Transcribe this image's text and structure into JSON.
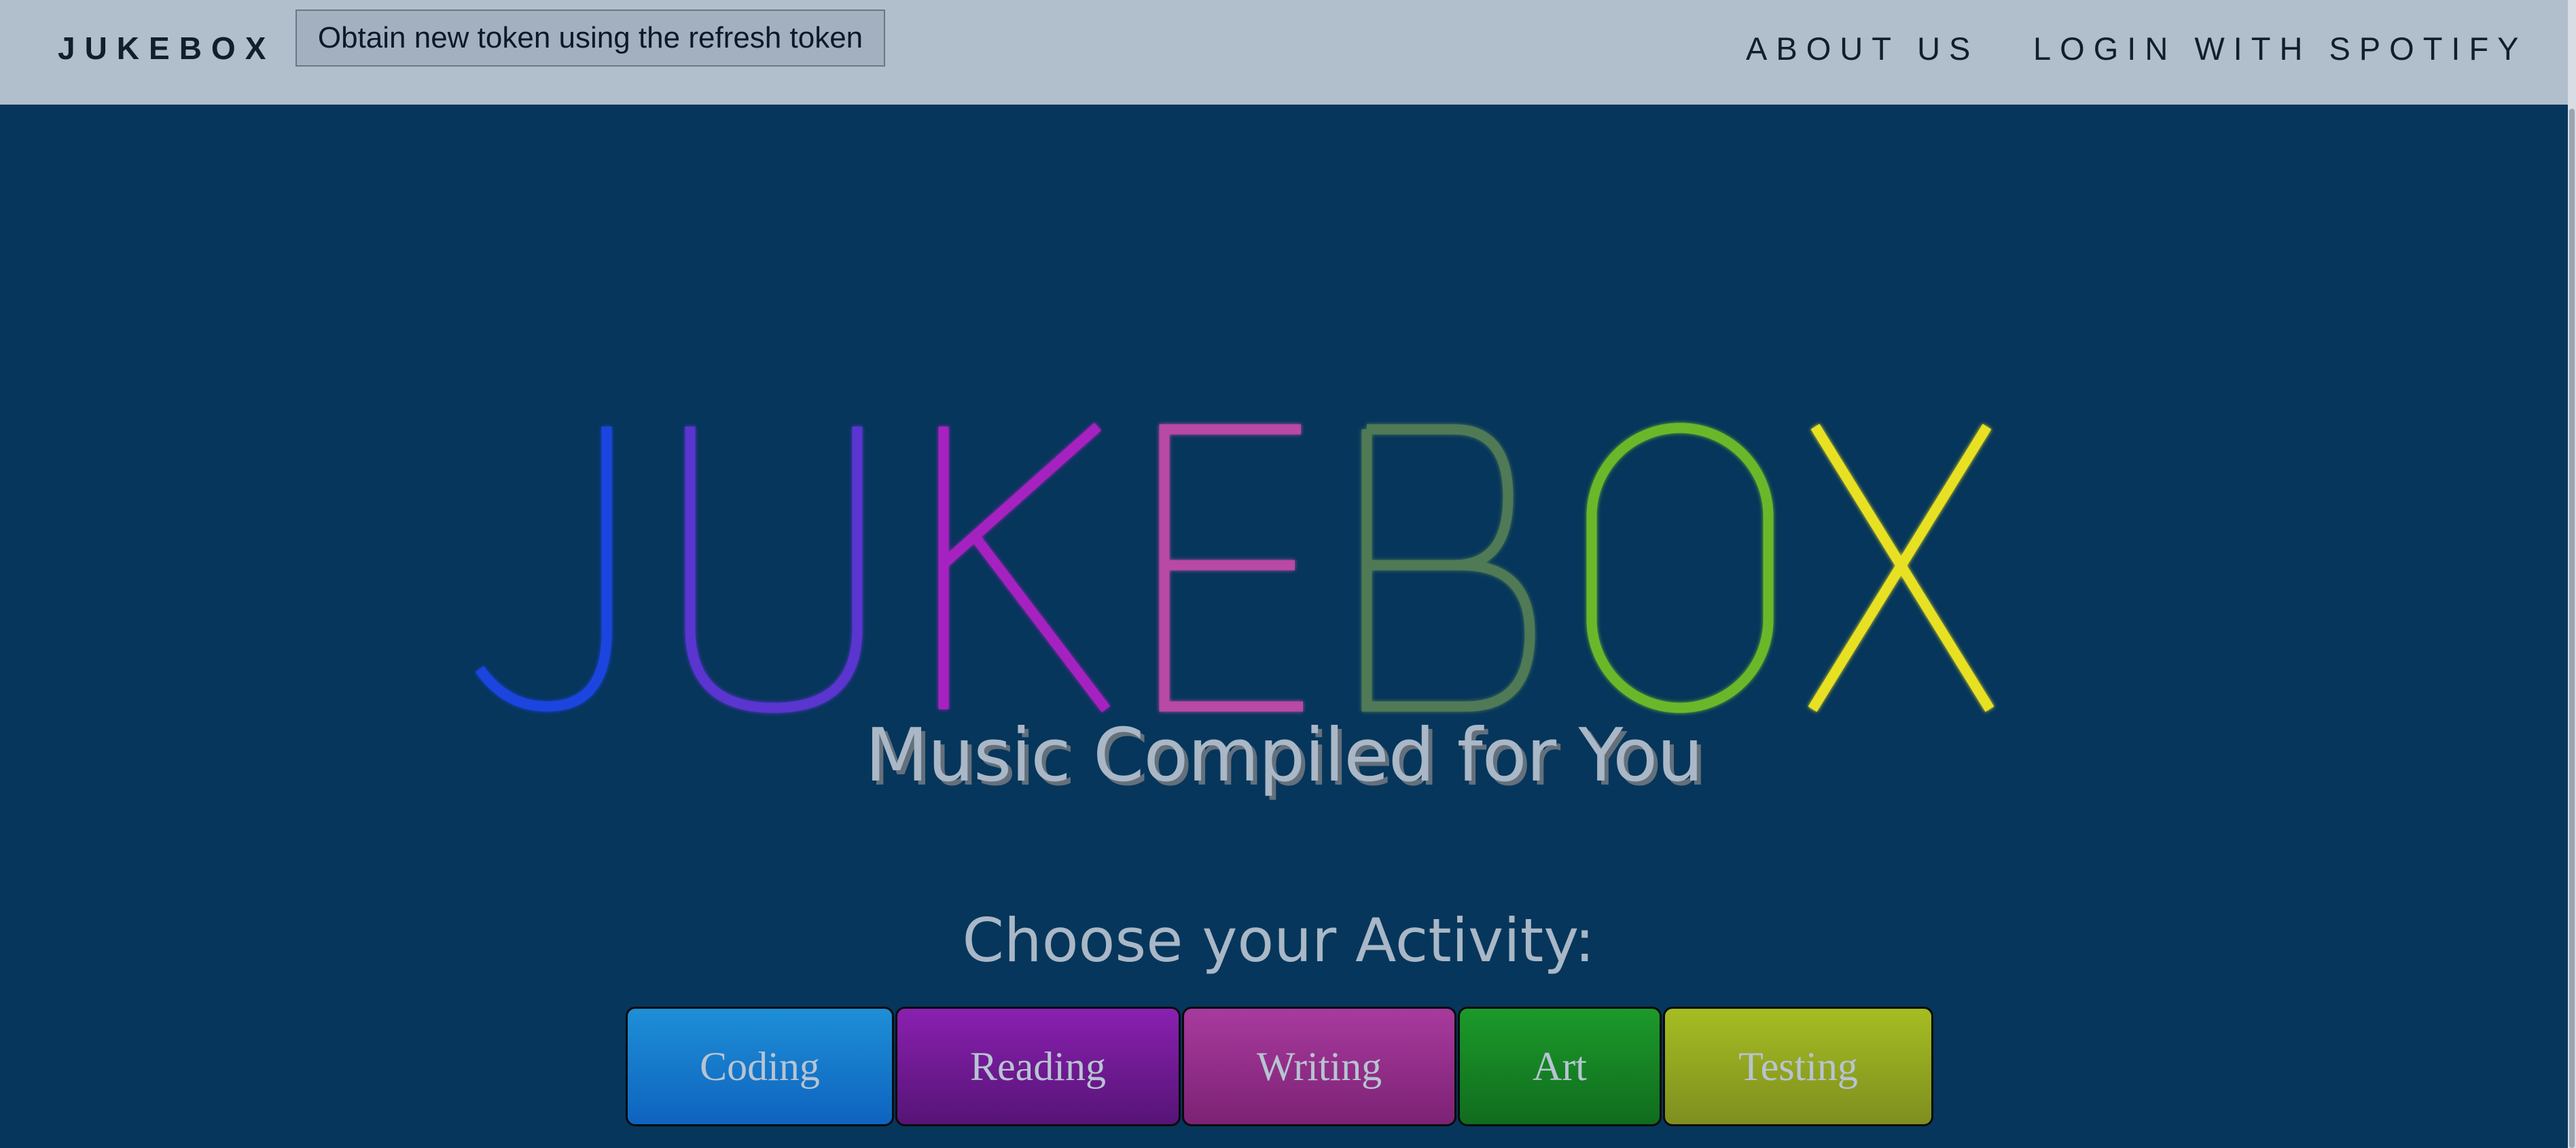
{
  "navbar": {
    "brand": "JUKEBOX",
    "token_button": "Obtain new token using the refresh token",
    "links": [
      {
        "label": "ABOUT US"
      },
      {
        "label": "LOGIN WITH SPOTIFY"
      }
    ],
    "background": "#b1becb"
  },
  "hero": {
    "logo_letters": [
      {
        "char": "J",
        "color": "#1a44e0"
      },
      {
        "char": "U",
        "color": "#5a34d0"
      },
      {
        "char": "K",
        "color": "#a624c0"
      },
      {
        "char": "E",
        "color": "#b84aa4"
      },
      {
        "char": "B",
        "color": "#4f7a55"
      },
      {
        "char": "O",
        "color": "#6bb82a"
      },
      {
        "char": "X",
        "color": "#e8e020"
      }
    ],
    "tagline": "Music Compiled for You",
    "prompt": "Choose your Activity:"
  },
  "activities": [
    {
      "label": "Coding",
      "color": "#1678cc"
    },
    {
      "label": "Reading",
      "color": "#6e1a96"
    },
    {
      "label": "Writing",
      "color": "#922e88"
    },
    {
      "label": "Art",
      "color": "#168424"
    },
    {
      "label": "Testing",
      "color": "#95a822"
    }
  ],
  "page_background": "#06365b"
}
